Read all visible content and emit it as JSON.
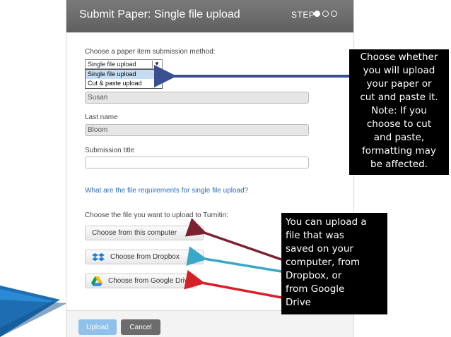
{
  "header": {
    "title": "Submit Paper: Single file upload",
    "step_label": "STEP"
  },
  "form": {
    "method_label": "Choose a paper item submission method:",
    "method_select_value": "Single file upload",
    "method_options": [
      "Single file upload",
      "Cut & paste upload"
    ],
    "first_name_value": "Susan",
    "last_name_label": "Last name",
    "last_name_value": "Bloom",
    "submission_title_label": "Submission title",
    "submission_title_value": "",
    "requirements_link": "What are the file requirements for single file upload?",
    "file_choose_label": "Choose the file you want to upload to Turnitin:",
    "btn_computer": "Choose from this computer",
    "btn_dropbox": "Choose from Dropbox",
    "btn_drive": "Choose from Google Drive"
  },
  "footer": {
    "upload": "Upload",
    "cancel": "Cancel"
  },
  "callouts": {
    "method": [
      "Choose whether",
      "you will upload",
      "your paper or",
      "cut and paste it.",
      "Note: If you",
      "choose to cut",
      "and paste,",
      "formatting may",
      "be affected."
    ],
    "upload": [
      "You can upload a",
      "file that was",
      "saved on your",
      "computer, from",
      "Dropbox, or",
      "from Google",
      "Drive"
    ]
  },
  "icons": {
    "dropbox": "dropbox-icon",
    "drive": "google-drive-icon"
  },
  "colors": {
    "header_bg": "#666666",
    "link": "#2a6db5",
    "upload_button": "#8fc1ea",
    "cancel_button": "#6c6c6c",
    "arrow_blue_dark": "#3a4f8f",
    "arrow_maroon": "#7a2233",
    "arrow_cyan": "#3aa7c9",
    "arrow_red": "#d62027",
    "slide_accent": "#1d6fb3"
  }
}
